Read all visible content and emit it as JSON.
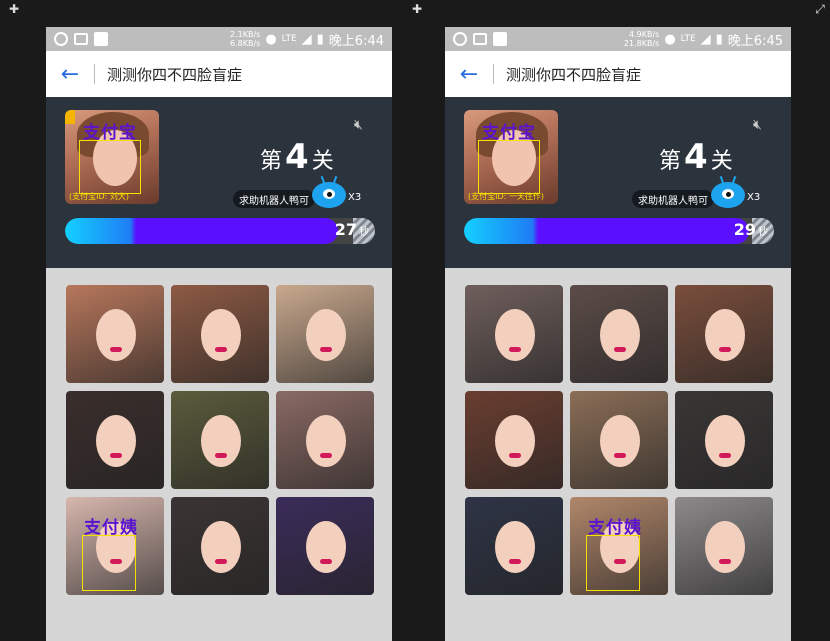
{
  "window": {
    "plus_icon": "plus-icon",
    "expand_icon": "expand-icon"
  },
  "screens": [
    {
      "status": {
        "speed_up": "2.1KB/s",
        "speed_down": "6.8KB/s",
        "network": "LTE",
        "time": "晚上6:44"
      },
      "header": {
        "title": "测测你四不四脸盲症"
      },
      "game": {
        "target_brand": "支付宝",
        "target_caption": "(支付宝ID: 刘大)",
        "level_prefix": "第",
        "level_num": "4",
        "level_suffix": "关",
        "helper_text": "求助机器人鸭可",
        "helper_count": "X3",
        "timer_seconds": "27",
        "timer_unit": "秒",
        "timer_progress": 0.88
      },
      "grid": [
        {
          "bg": "#b7775c",
          "brand": ""
        },
        {
          "bg": "#8d5a44",
          "brand": ""
        },
        {
          "bg": "#c9a98e",
          "brand": ""
        },
        {
          "bg": "#3a2e2c",
          "brand": ""
        },
        {
          "bg": "#5b5b3c",
          "brand": ""
        },
        {
          "bg": "#8a6a64",
          "brand": ""
        },
        {
          "bg": "#d7b7ae",
          "brand": "支付姨"
        },
        {
          "bg": "#3c3434",
          "brand": ""
        },
        {
          "bg": "#3b2c5a",
          "brand": ""
        }
      ]
    },
    {
      "status": {
        "speed_up": "4.9KB/s",
        "speed_down": "21.8KB/s",
        "network": "LTE",
        "time": "晚上6:45"
      },
      "header": {
        "title": "测测你四不四脸盲症"
      },
      "game": {
        "target_brand": "支付宝",
        "target_caption": "(支付宝ID: 一天往作)",
        "level_prefix": "第",
        "level_num": "4",
        "level_suffix": "关",
        "helper_text": "求助机器人鸭可",
        "helper_count": "X3",
        "timer_seconds": "29",
        "timer_unit": "秒",
        "timer_progress": 0.92
      },
      "grid": [
        {
          "bg": "#6f5f5c",
          "brand": ""
        },
        {
          "bg": "#5c4c48",
          "brand": ""
        },
        {
          "bg": "#7a4e3c",
          "brand": ""
        },
        {
          "bg": "#6a3e30",
          "brand": ""
        },
        {
          "bg": "#8b6e57",
          "brand": ""
        },
        {
          "bg": "#3a3636",
          "brand": ""
        },
        {
          "bg": "#2e3446",
          "brand": ""
        },
        {
          "bg": "#b1876a",
          "brand": "支付姨"
        },
        {
          "bg": "#8e8a8c",
          "brand": ""
        }
      ]
    }
  ]
}
